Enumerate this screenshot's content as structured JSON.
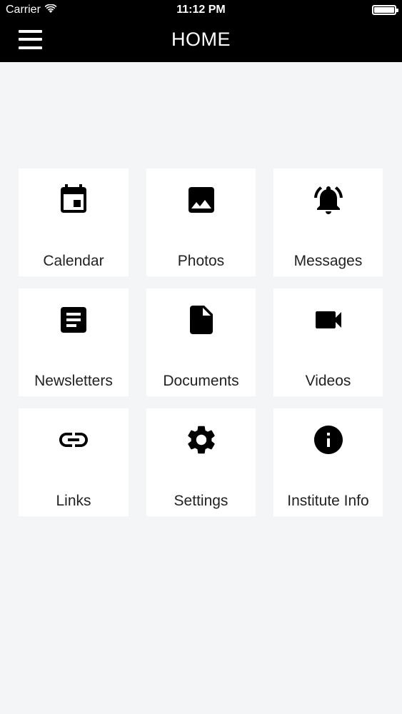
{
  "status_bar": {
    "carrier": "Carrier",
    "time": "11:12 PM"
  },
  "header": {
    "title": "HOME",
    "menu_icon": "hamburger-menu-icon"
  },
  "tiles": [
    {
      "label": "Calendar",
      "icon": "calendar-icon"
    },
    {
      "label": "Photos",
      "icon": "photo-icon"
    },
    {
      "label": "Messages",
      "icon": "bell-icon"
    },
    {
      "label": "Newsletters",
      "icon": "article-icon"
    },
    {
      "label": "Documents",
      "icon": "document-icon"
    },
    {
      "label": "Videos",
      "icon": "video-camera-icon"
    },
    {
      "label": "Links",
      "icon": "link-icon"
    },
    {
      "label": "Settings",
      "icon": "gear-icon"
    },
    {
      "label": "Institute Info",
      "icon": "info-icon"
    }
  ],
  "colors": {
    "header_bg": "#000000",
    "page_bg": "#f4f5f7",
    "tile_bg": "#ffffff",
    "icon": "#000000"
  }
}
